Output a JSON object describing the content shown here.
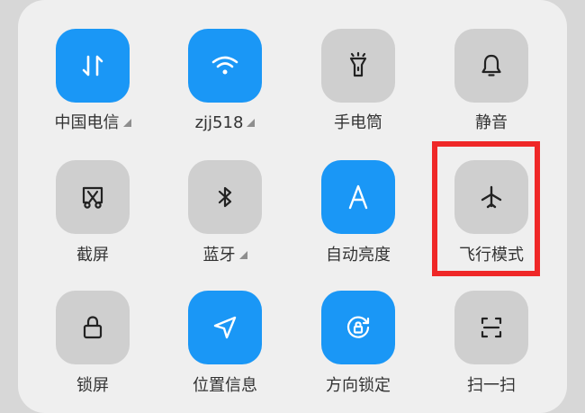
{
  "tiles": {
    "mobile_data": {
      "label": "中国电信",
      "icon": "mobile-data-icon",
      "state": "on"
    },
    "wifi": {
      "label": "zjj518",
      "icon": "wifi-icon",
      "state": "on"
    },
    "flashlight": {
      "label": "手电筒",
      "icon": "flashlight-icon",
      "state": "off"
    },
    "mute": {
      "label": "静音",
      "icon": "bell-icon",
      "state": "off"
    },
    "screenshot": {
      "label": "截屏",
      "icon": "screenshot-icon",
      "state": "off"
    },
    "bluetooth": {
      "label": "蓝牙",
      "icon": "bluetooth-icon",
      "state": "off"
    },
    "auto_brightness": {
      "label": "自动亮度",
      "icon": "letter-a-icon",
      "state": "on"
    },
    "airplane_mode": {
      "label": "飞行模式",
      "icon": "airplane-icon",
      "state": "off"
    },
    "lock_screen": {
      "label": "锁屏",
      "icon": "lock-icon",
      "state": "off"
    },
    "location": {
      "label": "位置信息",
      "icon": "navigation-arrow-icon",
      "state": "on"
    },
    "rotation_lock": {
      "label": "方向锁定",
      "icon": "rotation-lock-icon",
      "state": "on"
    },
    "scan": {
      "label": "扫一扫",
      "icon": "scan-icon",
      "state": "off"
    }
  },
  "colors": {
    "tile_on": "#1a97f6",
    "tile_off": "#cfcfcf",
    "highlight": "#ef2727",
    "label": "#333333"
  }
}
